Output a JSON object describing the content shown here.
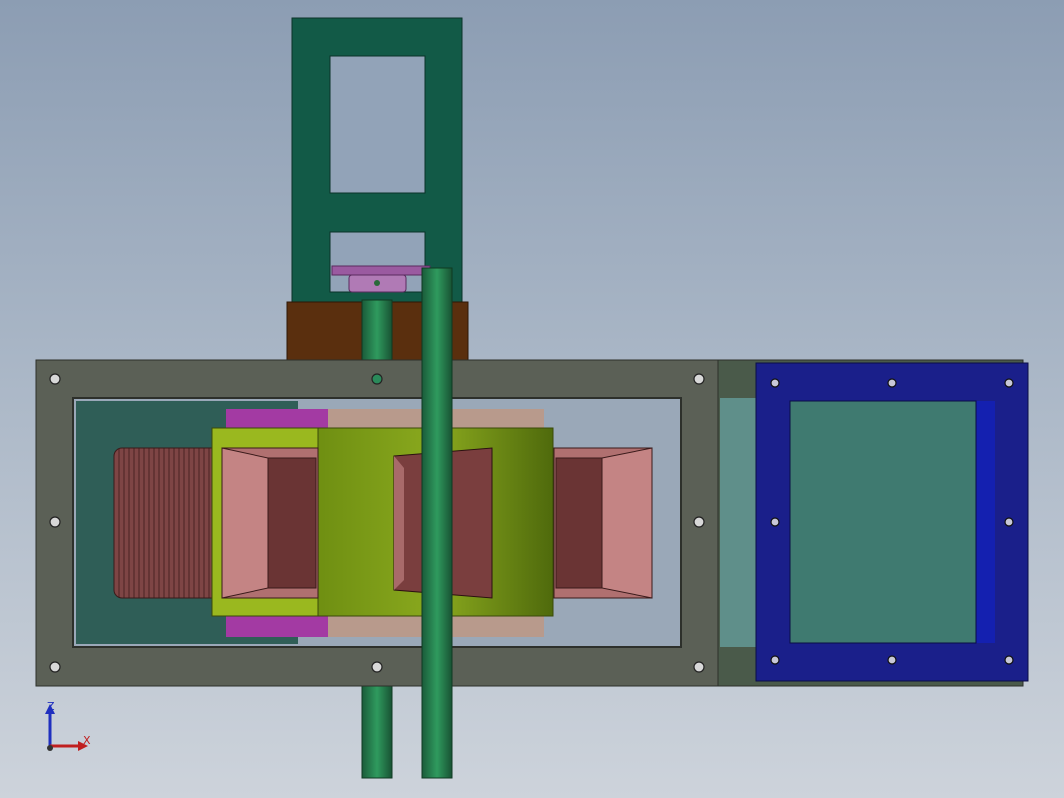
{
  "view": {
    "background_top": "#8c9db3",
    "background_bottom": "#cdd3db"
  },
  "triad": {
    "z_label": "Z",
    "x_label": "X",
    "z_color": "#1f2fbf",
    "x_color": "#c01f1f"
  },
  "colors": {
    "tower": "#125a47",
    "frame": "#5b6056",
    "frame_inner_dark": "#2f5e57",
    "shaft": "#1f7a4a",
    "brown_block": "#5a2f0e",
    "gear": "#8b4a8f",
    "magenta_band": "#a33aa3",
    "tan_band": "#b89a8c",
    "olive_body": "#6a8a16",
    "lime_panel": "#9ab81f",
    "cone": "#6a3a3a",
    "cone_light": "#a66a6a",
    "coil": "#7a4040",
    "blue_flange": "#1a1f8a",
    "teal_panel": "#3f7a70",
    "slot_teal": "#5f8f8a"
  }
}
